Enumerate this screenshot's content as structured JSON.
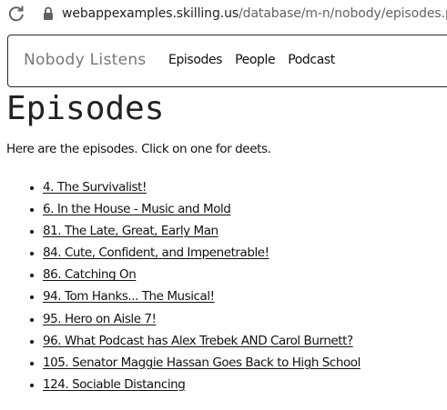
{
  "browser": {
    "url_host": "webappexamples.skilling.us",
    "url_path": "/database/m-n/nobody/episodes.php",
    "reload_icon": "reload-icon",
    "lock_icon": "lock-icon"
  },
  "navbar": {
    "brand": "Nobody Listens",
    "links": [
      {
        "label": "Episodes"
      },
      {
        "label": "People"
      },
      {
        "label": "Podcast"
      }
    ]
  },
  "main": {
    "title": "Episodes",
    "intro": "Here are the episodes. Click on one for deets.",
    "episodes": [
      {
        "label": "4. The Survivalist!"
      },
      {
        "label": "6. In the House - Music and Mold"
      },
      {
        "label": "81. The Late, Great, Early Man"
      },
      {
        "label": "84. Cute, Confident, and Impenetrable!"
      },
      {
        "label": "86. Catching On"
      },
      {
        "label": "94. Tom Hanks... The Musical!"
      },
      {
        "label": "95. Hero on Aisle 7!"
      },
      {
        "label": "96. What Podcast has Alex Trebek AND Carol Burnett?"
      },
      {
        "label": "105. Senator Maggie Hassan Goes Back to High School"
      },
      {
        "label": "124. Sociable Distancing"
      }
    ]
  }
}
